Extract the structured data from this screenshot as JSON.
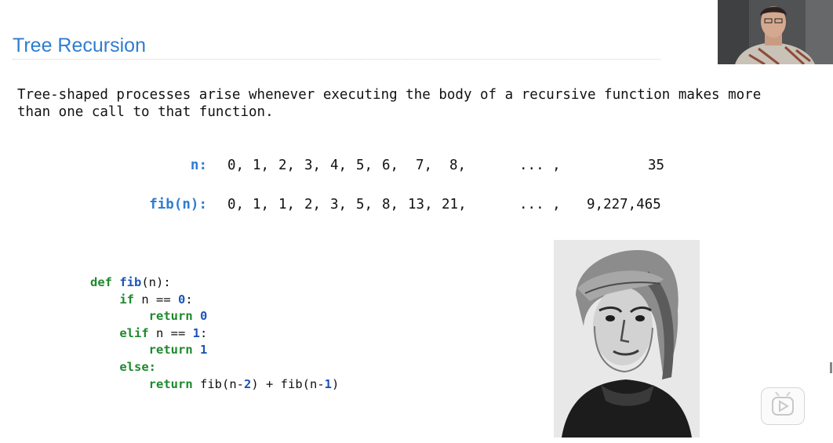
{
  "slide": {
    "title": "Tree Recursion",
    "intro_line1": "Tree-shaped processes arise whenever executing the body of a recursive function makes more",
    "intro_line2": "than one call to that function."
  },
  "sequence": {
    "n_label": "n:",
    "n_values": [
      "0,",
      "1,",
      "2,",
      "3,",
      "4,",
      "5,",
      "6,",
      "7,",
      "8,"
    ],
    "n_ellipsis": "... ,",
    "n_last": "35",
    "fib_label": "fib(n):",
    "fib_values": [
      "0,",
      "1,",
      "1,",
      "2,",
      "3,",
      "5,",
      "8,",
      "13,",
      "21,"
    ],
    "fib_ellipsis": "... ,",
    "fib_last": "9,227,465"
  },
  "code": {
    "def": "def",
    "fname": "fib",
    "params": "(n):",
    "if_kw": "if",
    "if_cond": "n == ",
    "if_num": "0",
    "colon": ":",
    "return_kw": "return",
    "ret0": "0",
    "elif_kw": "elif",
    "elif_cond": "n == ",
    "elif_num": "1",
    "ret1": "1",
    "else_kw": "else:",
    "ret_expr_a": "fib(n-",
    "ret_num_a": "2",
    "ret_expr_b": ") + fib(n-",
    "ret_num_b": "1",
    "ret_expr_c": ")"
  },
  "colors": {
    "title": "#2e7dd1",
    "keyword": "#1f8a2e",
    "function_name": "#1b55b8",
    "number": "#1b55b8"
  },
  "icons": {
    "portrait": "fibonacci-portrait-engraving",
    "webcam": "presenter-webcam-feed",
    "play": "play-icon"
  }
}
